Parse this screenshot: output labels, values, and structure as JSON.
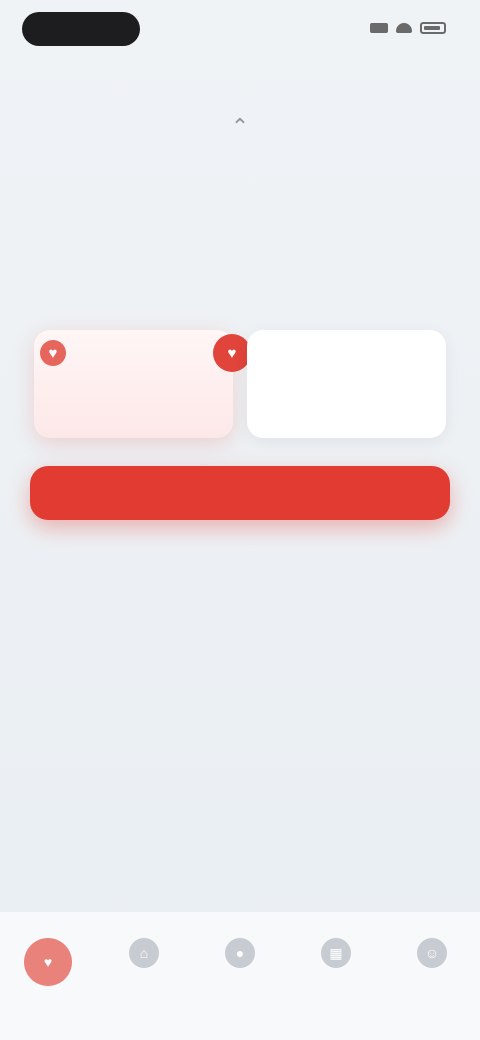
{
  "status_bar": {
    "icons": [
      "signal-icon",
      "wifi-icon",
      "battery-icon"
    ]
  },
  "hero": {
    "icon": "chevron-up-icon",
    "title": "",
    "subtitle": ""
  },
  "plans": [
    {
      "name": "",
      "price": "",
      "selected": true,
      "badge_icon": "heart-icon"
    },
    {
      "name": "",
      "price": "",
      "selected": false
    }
  ],
  "cta": {
    "label": "",
    "color": "#e23b32"
  },
  "secondary_link": "",
  "terms": "",
  "tab_bar": {
    "active_color": "#e25a52",
    "items": [
      {
        "label": "",
        "icon": "heart-icon",
        "active": true
      },
      {
        "label": "",
        "icon": "home-icon",
        "active": false
      },
      {
        "label": "",
        "icon": "chat-icon",
        "active": false
      },
      {
        "label": "",
        "icon": "calendar-icon",
        "active": false
      },
      {
        "label": "",
        "icon": "profile-icon",
        "active": false
      }
    ]
  }
}
